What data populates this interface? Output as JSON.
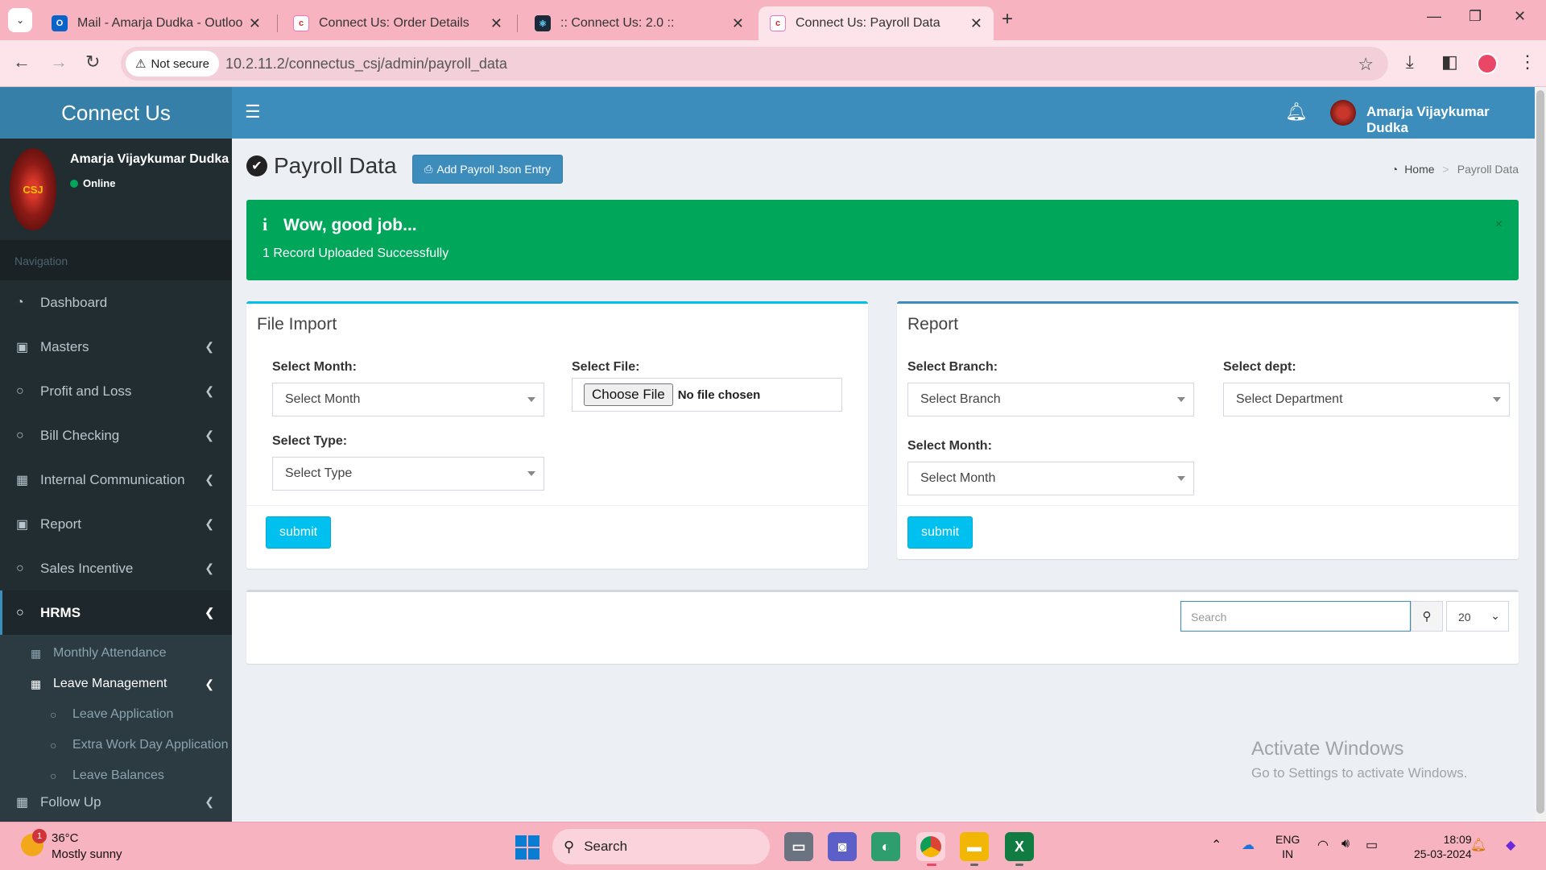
{
  "browser": {
    "tabs": [
      {
        "label": "Mail - Amarja Dudka - Outlook",
        "active": false
      },
      {
        "label": "Connect Us: Order Details",
        "active": false
      },
      {
        "label": ":: Connect Us: 2.0 ::",
        "active": false
      },
      {
        "label": "Connect Us: Payroll Data",
        "active": true
      }
    ],
    "security_label": "Not secure",
    "url": "10.2.11.2/connectus_csj/admin/payroll_data"
  },
  "app": {
    "logo": "Connect Us",
    "header_user": "Amarja Vijaykumar Dudka"
  },
  "sidebar": {
    "user_name": "Amarja Vijaykumar Dudka",
    "status": "Online",
    "avatar_text": "CSJ",
    "nav_header": "Navigation",
    "items": [
      {
        "label": "Dashboard",
        "icon": "dashboard-icon"
      },
      {
        "label": "Masters",
        "icon": "money-icon"
      },
      {
        "label": "Profit and Loss",
        "icon": "circle-icon"
      },
      {
        "label": "Bill Checking",
        "icon": "circle-icon"
      },
      {
        "label": "Internal Communication",
        "icon": "table-icon"
      },
      {
        "label": "Report",
        "icon": "money-icon"
      },
      {
        "label": "Sales Incentive",
        "icon": "circle-icon"
      },
      {
        "label": "HRMS",
        "icon": "circle-icon"
      }
    ],
    "hrms_sub": [
      {
        "label": "Monthly Attendance"
      },
      {
        "label": "Leave Management"
      }
    ],
    "leave_sub": [
      {
        "label": "Leave Application"
      },
      {
        "label": "Extra Work Day Application"
      },
      {
        "label": "Leave Balances"
      }
    ],
    "follow_up": "Follow Up"
  },
  "page": {
    "title": "Payroll Data",
    "add_button": "Add Payroll Json Entry",
    "breadcrumb": {
      "home": "Home",
      "current": "Payroll Data"
    }
  },
  "alert": {
    "title": "Wow, good job...",
    "message": "1 Record Uploaded Successfully",
    "close": "×"
  },
  "file_import": {
    "title": "File Import",
    "month_label": "Select Month:",
    "month_value": "Select Month",
    "file_label": "Select File:",
    "file_button": "Choose File",
    "file_status": "No file chosen",
    "type_label": "Select Type:",
    "type_value": "Select Type",
    "submit": "submit"
  },
  "report": {
    "title": "Report",
    "branch_label": "Select Branch:",
    "branch_value": "Select Branch",
    "dept_label": "Select dept:",
    "dept_value": "Select Department",
    "month_label": "Select Month:",
    "month_value": "Select Month",
    "submit": "submit"
  },
  "table_controls": {
    "search_placeholder": "Search",
    "page_size": "20"
  },
  "watermark": {
    "line1": "Activate Windows",
    "line2": "Go to Settings to activate Windows."
  },
  "taskbar": {
    "temperature": "36°C",
    "weather": "Mostly sunny",
    "weather_badge": "1",
    "search": "Search",
    "lang_top": "ENG",
    "lang_bottom": "IN",
    "time": "18:09",
    "date": "25-03-2024"
  },
  "colors": {
    "header": "#3c8dbc",
    "sidebar": "#222d32",
    "success": "#00a65a",
    "info_button": "#00c0ef",
    "browser_chrome": "#f8b3c0"
  }
}
